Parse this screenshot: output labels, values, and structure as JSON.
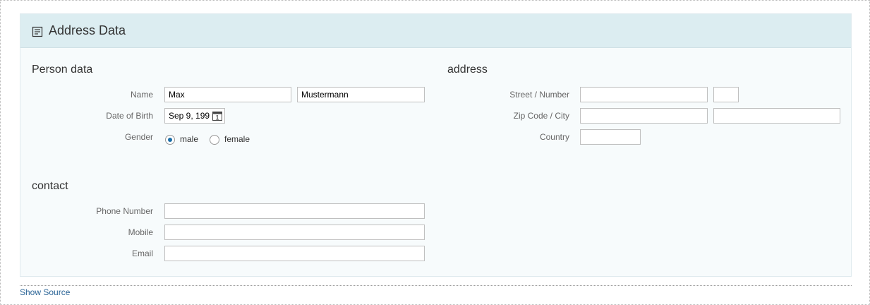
{
  "panel": {
    "title": "Address Data",
    "icon": "form-icon"
  },
  "person": {
    "title": "Person data",
    "name_label": "Name",
    "first_name": "Max",
    "last_name": "Mustermann",
    "dob_label": "Date of Birth",
    "dob_value": "Sep 9, 199",
    "calendar_glyph": "1",
    "gender_label": "Gender",
    "gender_options": [
      "male",
      "female"
    ],
    "gender_selected": "male"
  },
  "address": {
    "title": "address",
    "street_label": "Street / Number",
    "street_value": "",
    "number_value": "",
    "zip_label": "Zip Code / City",
    "zip_value": "",
    "city_value": "",
    "country_label": "Country",
    "country_value": ""
  },
  "contact": {
    "title": "contact",
    "phone_label": "Phone Number",
    "phone_value": "",
    "mobile_label": "Mobile",
    "mobile_value": "",
    "email_label": "Email",
    "email_value": ""
  },
  "footer": {
    "show_source": "Show Source"
  },
  "colors": {
    "header_bg": "#dcedf1",
    "panel_bg": "#f7fbfc",
    "radio_accent": "#1a6ea8",
    "link": "#2a6496"
  }
}
